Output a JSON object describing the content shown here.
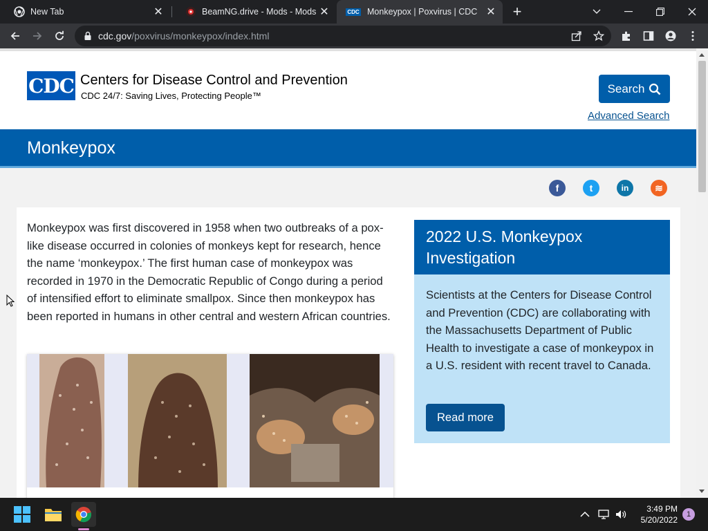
{
  "browser": {
    "tabs": [
      {
        "title": "New Tab",
        "favicon": "chrome-icon",
        "active": false
      },
      {
        "title": "BeamNG.drive - Mods - Mods fo",
        "favicon": "beamng-icon",
        "active": false
      },
      {
        "title": "Monkeypox | Poxvirus | CDC",
        "favicon": "cdc-favicon",
        "active": true
      }
    ],
    "favicon_text": "CDC",
    "new_tab_label": "+",
    "url_host": "cdc.gov",
    "url_path": "/poxvirus/monkeypox/index.html"
  },
  "header": {
    "logo_text": "CDC",
    "org_name": "Centers for Disease Control and Prevention",
    "org_tagline": "CDC 24/7: Saving Lives, Protecting People™",
    "search_label": "Search",
    "advanced_search_label": "Advanced Search"
  },
  "banner": {
    "title": "Monkeypox"
  },
  "social": [
    {
      "name": "facebook",
      "glyph": "f",
      "color": "#3b5998"
    },
    {
      "name": "twitter",
      "glyph": "t",
      "color": "#1da1f2"
    },
    {
      "name": "linkedin",
      "glyph": "in",
      "color": "#0e76a8"
    },
    {
      "name": "syndicate",
      "glyph": "≋",
      "color": "#f26522"
    }
  ],
  "main": {
    "intro": "Monkeypox was first discovered in 1958 when two outbreaks of a pox-like disease occurred in colonies of monkeys kept for research, hence the name ‘monkeypox.’ The first human case of monkeypox was recorded in 1970 in the Democratic Republic of Congo during a period of intensified effort to eliminate smallpox. Since then monkeypox has been reported in humans in other central and western African countries."
  },
  "callout": {
    "title": "2022 U.S. Monkeypox Investigation",
    "body": "Scientists at the Centers for Disease Control and Prevention (CDC) are collaborating with the Massachusetts Department of Public Health to investigate a case of monkeypox in a U.S. resident with recent travel to Canada.",
    "button_label": "Read more"
  },
  "taskbar": {
    "time": "3:49 PM",
    "date": "5/20/2022",
    "notification_count": "1"
  },
  "colors": {
    "cdc_blue": "#005eaa",
    "callout_bg": "#bfe2f7",
    "link": "#075290"
  }
}
